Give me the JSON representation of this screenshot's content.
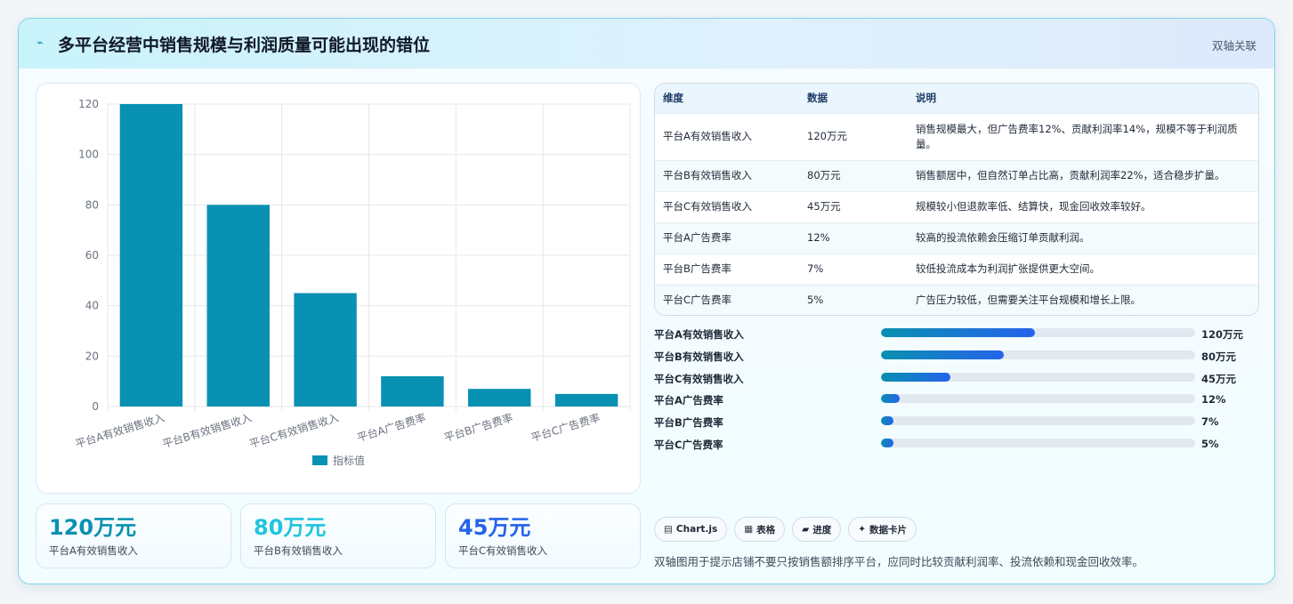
{
  "header": {
    "title": "多平台经营中销售规模与利润质量可能出现的错位",
    "tag": "双轴关联"
  },
  "chart_data": {
    "type": "bar",
    "categories": [
      "平台A有效销售收入",
      "平台B有效销售收入",
      "平台C有效销售收入",
      "平台A广告费率",
      "平台B广告费率",
      "平台C广告费率"
    ],
    "series": [
      {
        "name": "指标值",
        "values": [
          120,
          80,
          45,
          12,
          7,
          5
        ]
      }
    ],
    "ylim": [
      0,
      120
    ],
    "yticks": [
      0,
      20,
      40,
      60,
      80,
      100,
      120
    ],
    "color": "#0891b2",
    "grid": true,
    "legend": "bottom"
  },
  "kpis": [
    {
      "value": "120万元",
      "label": "平台A有效销售收入",
      "color": "#0891b2"
    },
    {
      "value": "80万元",
      "label": "平台B有效销售收入",
      "color": "#22c3dd"
    },
    {
      "value": "45万元",
      "label": "平台C有效销售收入",
      "color": "#2563eb"
    }
  ],
  "table": {
    "headers": [
      "维度",
      "数据",
      "说明"
    ],
    "rows": [
      [
        "平台A有效销售收入",
        "120万元",
        "销售规模最大，但广告费率12%、贡献利润率14%，规模不等于利润质量。"
      ],
      [
        "平台B有效销售收入",
        "80万元",
        "销售额居中，但自然订单占比高，贡献利润率22%，适合稳步扩量。"
      ],
      [
        "平台C有效销售收入",
        "45万元",
        "规模较小但退款率低、结算快，现金回收效率较好。"
      ],
      [
        "平台A广告费率",
        "12%",
        "较高的投流依赖会压缩订单贡献利润。"
      ],
      [
        "平台B广告费率",
        "7%",
        "较低投流成本为利润扩张提供更大空间。"
      ],
      [
        "平台C广告费率",
        "5%",
        "广告压力较低，但需要关注平台规模和增长上限。"
      ]
    ]
  },
  "bars": [
    {
      "label": "平台A有效销售收入",
      "value": "120万元",
      "fraction": 0.49
    },
    {
      "label": "平台B有效销售收入",
      "value": "80万元",
      "fraction": 0.39
    },
    {
      "label": "平台C有效销售收入",
      "value": "45万元",
      "fraction": 0.22
    },
    {
      "label": "平台A广告费率",
      "value": "12%",
      "fraction": 0.06
    },
    {
      "label": "平台B广告费率",
      "value": "7%",
      "fraction": 0.04
    },
    {
      "label": "平台C广告费率",
      "value": "5%",
      "fraction": 0.04
    }
  ],
  "chips": [
    {
      "icon": "chart-icon",
      "glyph": "▤",
      "label": "Chart.js"
    },
    {
      "icon": "table-icon",
      "glyph": "▦",
      "label": "表格"
    },
    {
      "icon": "progress-icon",
      "glyph": "▰",
      "label": "进度"
    },
    {
      "icon": "card-icon",
      "glyph": "✦",
      "label": "数据卡片"
    }
  ],
  "note": "双轴图用于提示店铺不要只按销售额排序平台，应同时比较贡献利润率、投流依赖和现金回收效率。"
}
